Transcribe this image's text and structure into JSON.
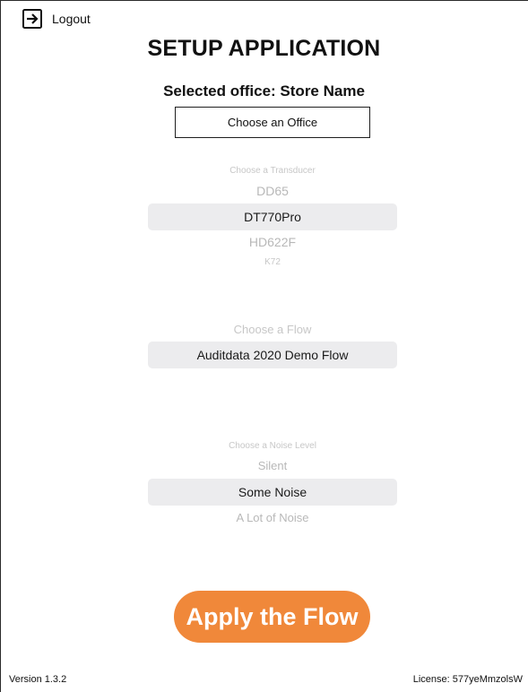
{
  "header": {
    "logout_label": "Logout",
    "logout_icon": "logout-icon"
  },
  "page": {
    "title": "SETUP APPLICATION",
    "selected_office": "Selected office: Store Name",
    "choose_office_label": "Choose an Office"
  },
  "transducer_picker": {
    "label": "Choose a Transducer",
    "items_above": [
      "DD65"
    ],
    "selected": "DT770Pro",
    "items_below": [
      "HD622F",
      "K72"
    ]
  },
  "flow_picker": {
    "label": "Choose a Flow",
    "selected": "Auditdata 2020 Demo Flow"
  },
  "noise_picker": {
    "label": "Choose a Noise Level",
    "items_above": [
      "Silent"
    ],
    "selected": "Some Noise",
    "items_below": [
      "A Lot of Noise"
    ]
  },
  "actions": {
    "apply_label": "Apply the Flow"
  },
  "footer": {
    "version": "Version 1.3.2",
    "license": "License: 577yeMmzolsW"
  },
  "colors": {
    "accent": "#f0883a",
    "picker_highlight": "#ececee",
    "picker_text_muted": "#b8b8b8"
  }
}
